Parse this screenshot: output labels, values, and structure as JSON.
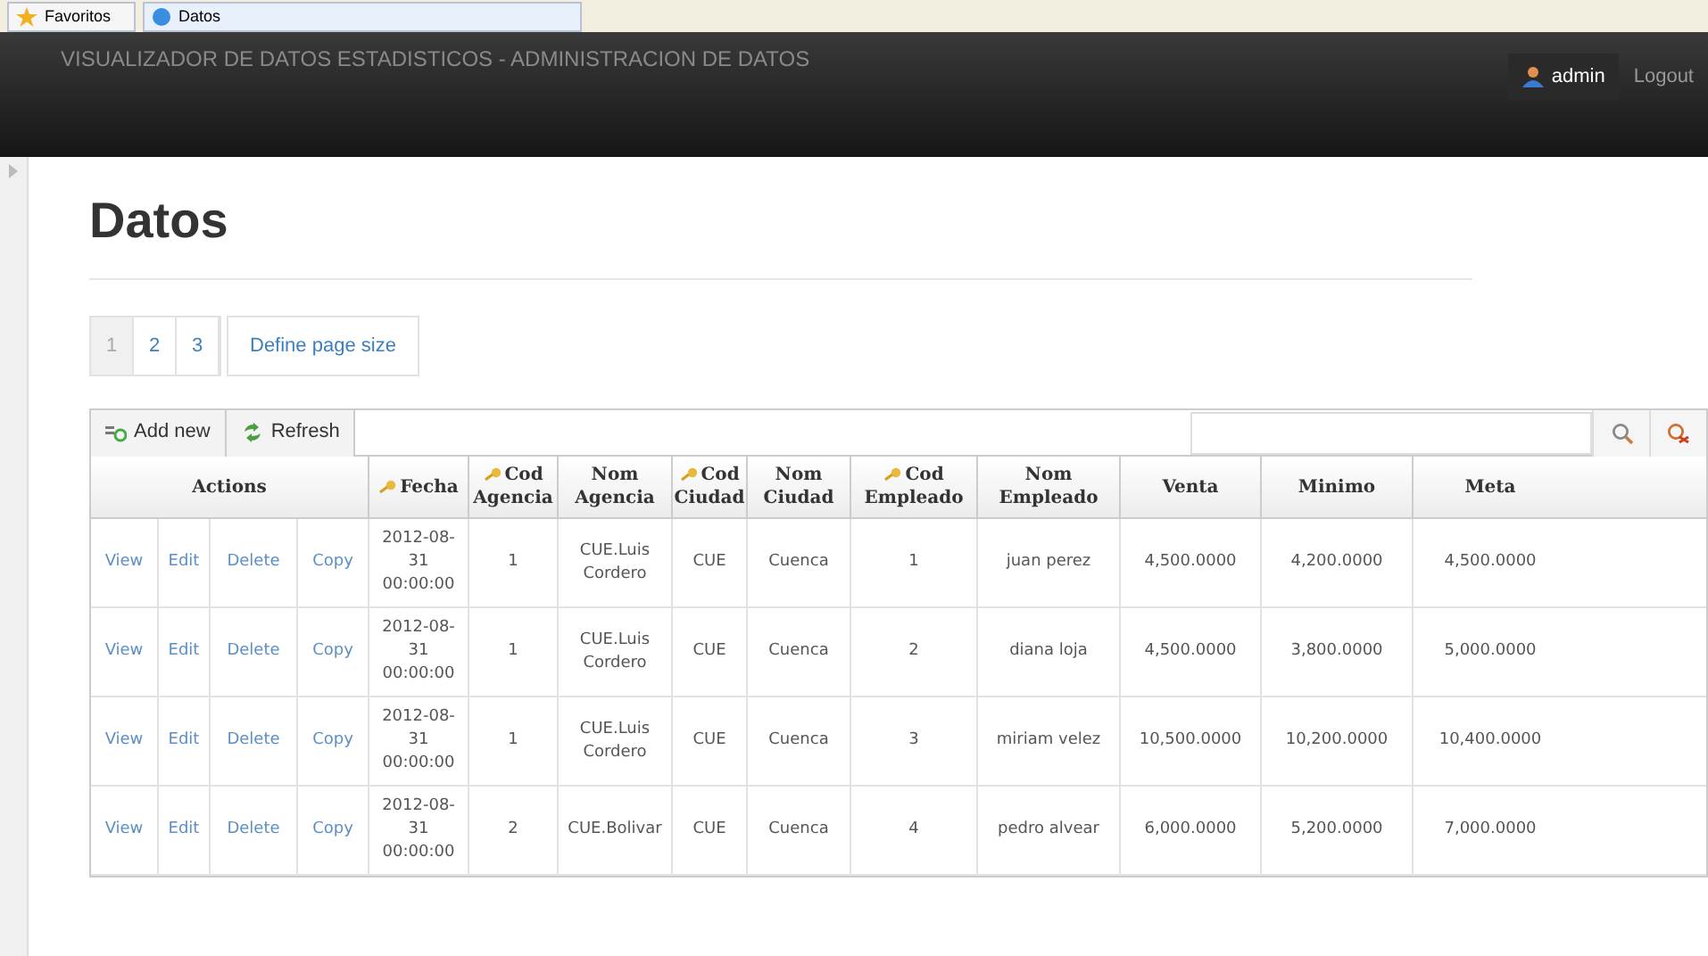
{
  "browser_tabs": [
    {
      "label": "Favoritos",
      "selected": false
    },
    {
      "label": "Datos",
      "selected": true
    }
  ],
  "header": {
    "title": "VISUALIZADOR DE DATOS ESTADISTICOS - ADMINISTRACION DE DATOS",
    "user": "admin",
    "logout": "Logout"
  },
  "page_title": "Datos",
  "pager": [
    {
      "label": "1",
      "selected": true
    },
    {
      "label": "2",
      "selected": false
    },
    {
      "label": "3",
      "selected": false
    }
  ],
  "page_size_button": "Define page size",
  "toolbar": {
    "add": "Add new",
    "refresh": "Refresh"
  },
  "table": {
    "actions_header": "Actions",
    "columns": [
      {
        "label": "Fecha",
        "key": true
      },
      {
        "label": "Cod Agencia",
        "key": true
      },
      {
        "label": "Nom Agencia",
        "key": false
      },
      {
        "label": "Cod Ciudad",
        "key": true
      },
      {
        "label": "Nom Ciudad",
        "key": false
      },
      {
        "label": "Cod Empleado",
        "key": true
      },
      {
        "label": "Nom Empleado",
        "key": false
      },
      {
        "label": "Venta",
        "key": false
      },
      {
        "label": "Minimo",
        "key": false
      },
      {
        "label": "Meta",
        "key": false
      }
    ],
    "rows": [
      {
        "actions": [
          "View",
          "Edit",
          "Delete",
          "Copy"
        ],
        "cells": [
          "2012-08-31 00:00:00",
          "1",
          "CUE.Luis Cordero",
          "CUE",
          "Cuenca",
          "1",
          "juan perez",
          "4,500.0000",
          "4,200.0000",
          "4,500.0000"
        ]
      },
      {
        "actions": [
          "View",
          "Edit",
          "Delete",
          "Copy"
        ],
        "cells": [
          "2012-08-31 00:00:00",
          "1",
          "CUE.Luis Cordero",
          "CUE",
          "Cuenca",
          "2",
          "diana loja",
          "4,500.0000",
          "3,800.0000",
          "5,000.0000"
        ]
      },
      {
        "actions": [
          "View",
          "Edit",
          "Delete",
          "Copy"
        ],
        "cells": [
          "2012-08-31 00:00:00",
          "1",
          "CUE.Luis Cordero",
          "CUE",
          "Cuenca",
          "3",
          "miriam velez",
          "10,500.0000",
          "10,200.0000",
          "10,400.0000"
        ]
      },
      {
        "actions": [
          "View",
          "Edit",
          "Delete",
          "Copy"
        ],
        "cells": [
          "2012-08-31 00:00:00",
          "2",
          "CUE.Bolivar",
          "CUE",
          "Cuenca",
          "4",
          "pedro alvear",
          "6,000.0000",
          "5,200.0000",
          "7,000.0000"
        ]
      }
    ]
  }
}
